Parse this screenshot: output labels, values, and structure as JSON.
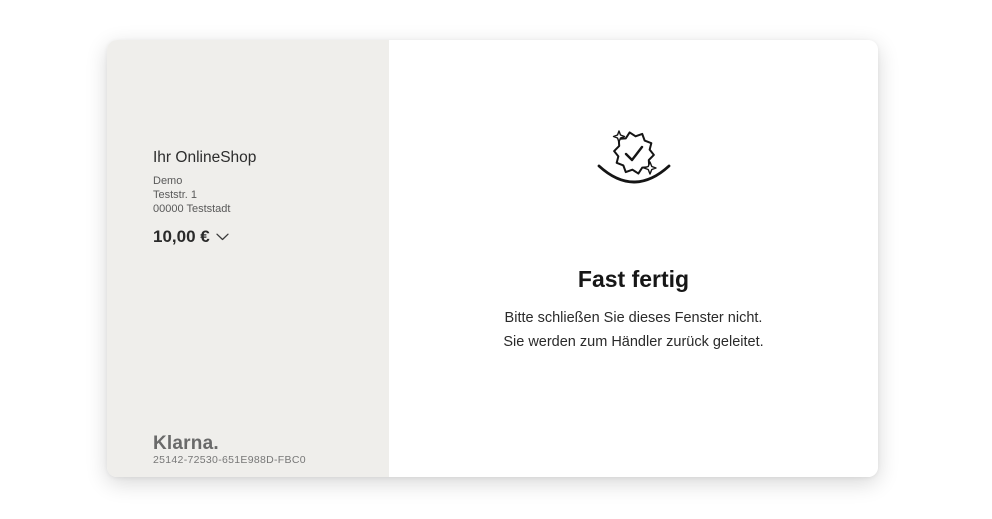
{
  "merchant": {
    "name": "Ihr OnlineShop",
    "address_lines": [
      "Demo",
      "Teststr. 1",
      "00000 Teststadt"
    ]
  },
  "order": {
    "amount": "10,00 €"
  },
  "footer": {
    "brand": "Klarna.",
    "session_id": "25142-72530-651E988D-FBC0"
  },
  "status": {
    "icon": "verified-badge-icon",
    "title": "Fast fertig",
    "message_lines": [
      "Bitte schließen Sie dieses Fenster nicht.",
      "Sie werden zum Händler zurück geleitet."
    ]
  },
  "colors": {
    "sidebar_bg": "#efeeeb",
    "text": "#1a1a1a"
  }
}
